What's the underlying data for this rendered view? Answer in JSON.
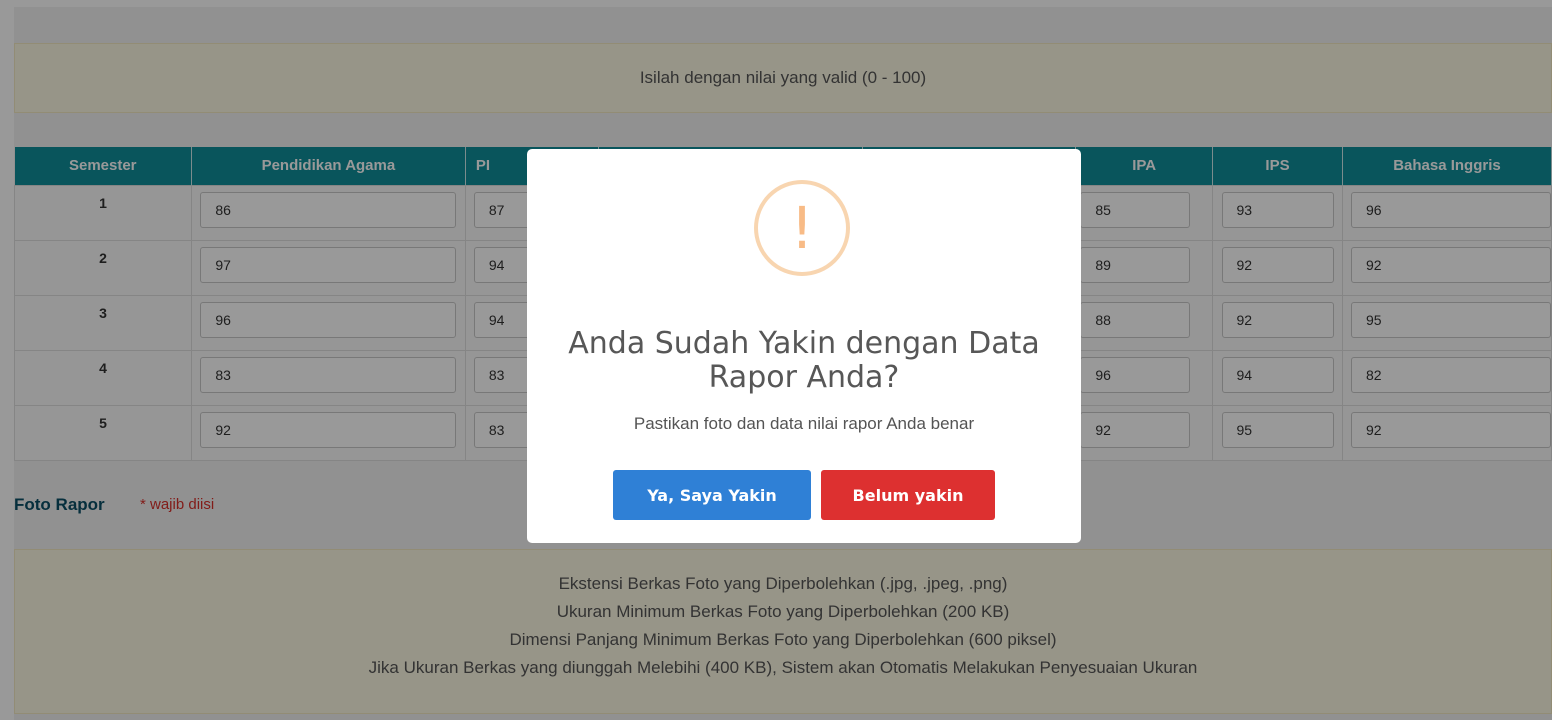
{
  "alert_valid": "Isilah dengan nilai yang valid (0 - 100)",
  "table": {
    "headers": [
      "Semester",
      "Pendidikan Agama",
      "PI",
      "",
      "",
      "IPA",
      "IPS",
      "Bahasa Inggris"
    ],
    "rows": [
      {
        "semester": "1",
        "agama": "86",
        "p2": "87",
        "ipa": "85",
        "ips": "93",
        "inggris": "96"
      },
      {
        "semester": "2",
        "agama": "97",
        "p2": "94",
        "ipa": "89",
        "ips": "92",
        "inggris": "92"
      },
      {
        "semester": "3",
        "agama": "96",
        "p2": "94",
        "ipa": "88",
        "ips": "92",
        "inggris": "95"
      },
      {
        "semester": "4",
        "agama": "83",
        "p2": "83",
        "ipa": "96",
        "ips": "94",
        "inggris": "82"
      },
      {
        "semester": "5",
        "agama": "92",
        "p2": "83",
        "ipa": "92",
        "ips": "95",
        "inggris": "92"
      }
    ]
  },
  "foto": {
    "label": "Foto Rapor",
    "required": "* wajib diisi"
  },
  "info_lines": [
    "Ekstensi Berkas Foto yang Diperbolehkan (.jpg, .jpeg, .png)",
    "Ukuran Minimum Berkas Foto yang Diperbolehkan (200 KB)",
    "Dimensi Panjang Minimum Berkas Foto yang Diperbolehkan (600 piksel)",
    "Jika Ukuran Berkas yang diunggah Melebihi (400 KB), Sistem akan Otomatis Melakukan Penyesuaian Ukuran"
  ],
  "modal": {
    "icon_glyph": "!",
    "icon": "warning-icon",
    "title": "Anda Sudah Yakin dengan Data Rapor Anda?",
    "text": "Pastikan foto dan data nilai rapor Anda benar",
    "confirm_label": "Ya, Saya Yakin",
    "cancel_label": "Belum yakin"
  },
  "colors": {
    "table_header": "#0f8e99",
    "alert_bg": "#fcf8e3",
    "confirm": "#2f80d6",
    "cancel": "#dd3030",
    "warning": "#f8bb86"
  }
}
